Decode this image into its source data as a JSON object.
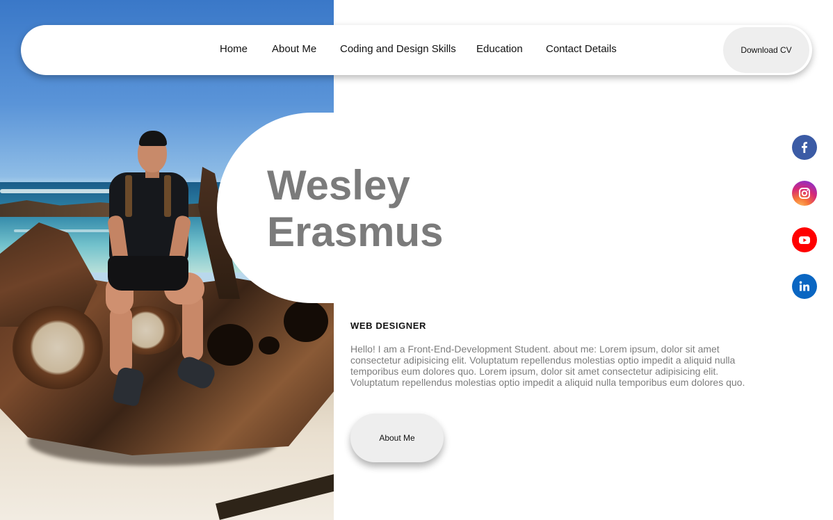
{
  "nav": {
    "links": [
      "Home",
      "About Me",
      "Coding and Design Skills",
      "Education",
      "Contact Details"
    ],
    "cv_label": "Download CV"
  },
  "hero": {
    "first_name": "Wesley",
    "last_name": "Erasmus",
    "role": "WEB DESIGNER",
    "bio": "Hello! I am a Front-End-Development Student. about me: Lorem ipsum, dolor sit amet consectetur adipisicing elit. Voluptatum repellendus molestias optio impedit a aliquid nulla temporibus eum dolores quo. Lorem ipsum, dolor sit amet consectetur adipisicing elit. Voluptatum repellendus molestias optio impedit a aliquid nulla temporibus eum dolores quo.",
    "about_label": "About Me",
    "photo_icon": "profile-photo"
  },
  "social": [
    {
      "icon": "facebook-icon",
      "color": "#3b5ba5"
    },
    {
      "icon": "instagram-icon",
      "color": "#d62976"
    },
    {
      "icon": "youtube-icon",
      "color": "#ff0000"
    },
    {
      "icon": "linkedin-icon",
      "color": "#0a66c2"
    }
  ],
  "colors": {
    "name_text": "#7b7b7b",
    "bio_text": "#7d7d7d",
    "button_bg": "#eeeeee"
  }
}
